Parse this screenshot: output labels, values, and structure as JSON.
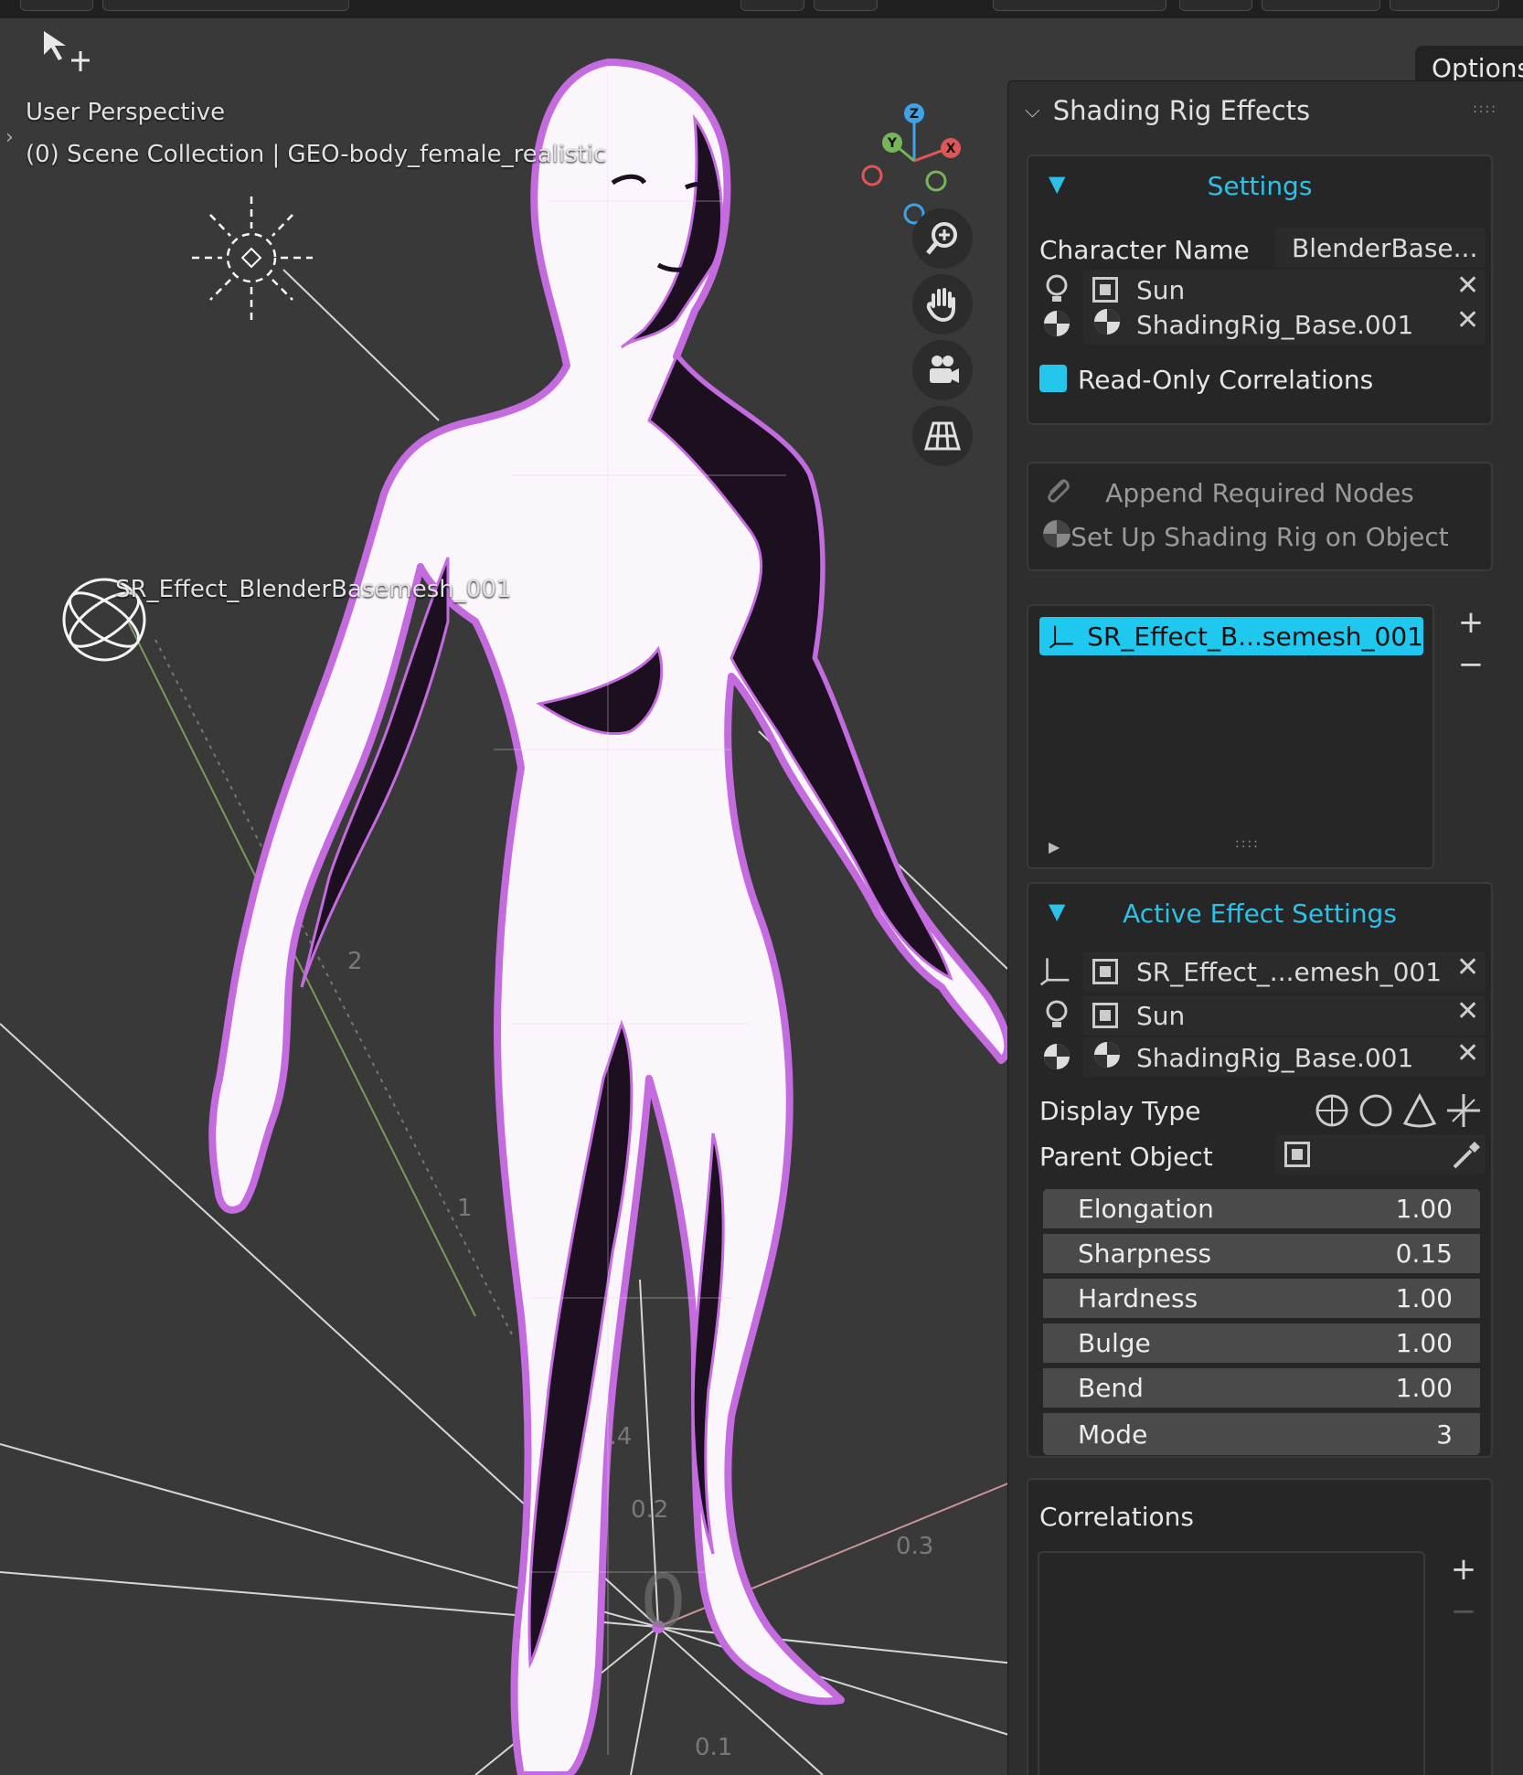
{
  "viewport": {
    "perspective_label": "User Perspective",
    "collection_label": "(0) Scene Collection | GEO-body_female_realistic",
    "object_label": "SR_Effect_BlenderBasemesh_001",
    "options_label": "Options",
    "axis_labels": {
      "z": "Z",
      "y": "Y",
      "x": "X"
    }
  },
  "panel": {
    "title": "Shading Rig Effects",
    "settings": {
      "title": "Settings",
      "character_name_label": "Character Name",
      "character_name_value": "BlenderBase...",
      "light_object": "Sun",
      "rig_object": "ShadingRig_Base.001",
      "read_only_label": "Read-Only Correlations"
    },
    "actions": {
      "append_label": "Append Required Nodes",
      "setup_label": "Set Up Shading Rig on Object"
    },
    "effects_list": {
      "items": [
        "SR_Effect_B...semesh_001"
      ],
      "add": "+",
      "remove": "−"
    },
    "active_effect": {
      "title": "Active Effect Settings",
      "effect_object": "SR_Effect_...emesh_001",
      "light_object": "Sun",
      "rig_object": "ShadingRig_Base.001",
      "display_type_label": "Display Type",
      "parent_object_label": "Parent Object",
      "params": [
        {
          "label": "Elongation",
          "value": "1.00"
        },
        {
          "label": "Sharpness",
          "value": "0.15"
        },
        {
          "label": "Hardness",
          "value": "1.00"
        },
        {
          "label": "Bulge",
          "value": "1.00"
        },
        {
          "label": "Bend",
          "value": "1.00"
        },
        {
          "label": "Mode",
          "value": "3"
        }
      ]
    },
    "correlations": {
      "title": "Correlations",
      "add": "+",
      "remove": "−"
    }
  },
  "colors": {
    "accent": "#1ec8ef",
    "viewport_bg": "#393939",
    "panel_bg": "#2e2e2e",
    "mesh_outline": "#c46be0",
    "mesh_shadow": "#1c0f20"
  }
}
